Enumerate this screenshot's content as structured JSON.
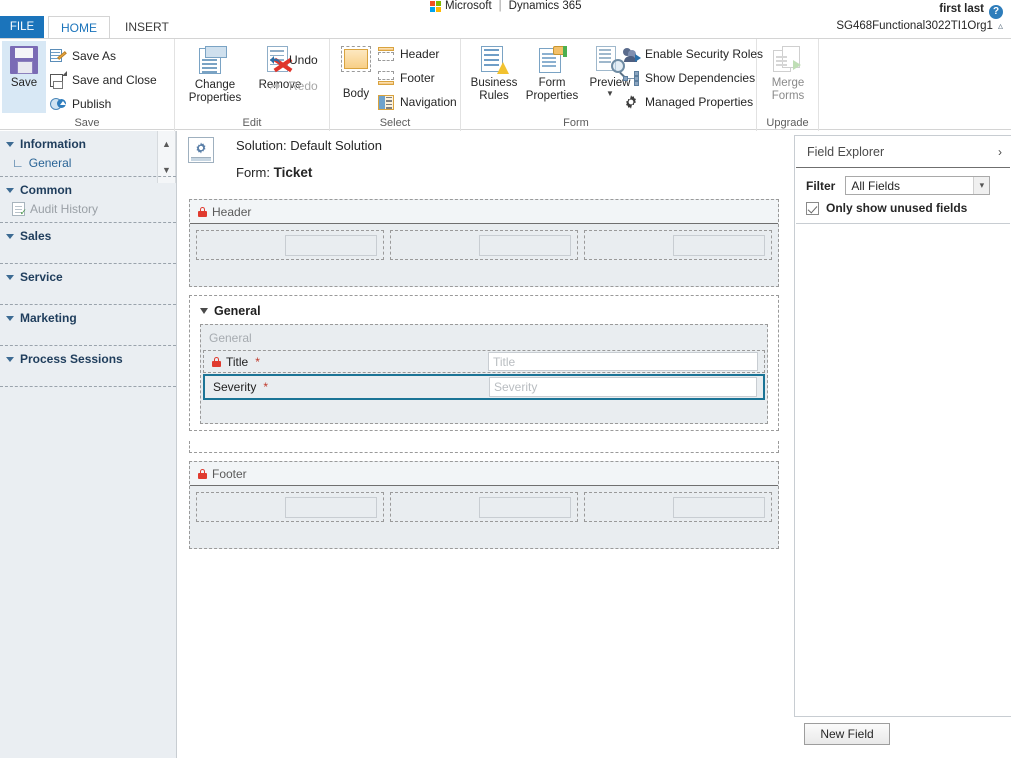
{
  "brand": {
    "company": "Microsoft",
    "separator": "|",
    "product": "Dynamics 365",
    "logo_icon": "microsoft-logo-icon",
    "colors": {
      "red": "#f25022",
      "green": "#7fba00",
      "blue": "#00a4ef",
      "yellow": "#ffb900"
    }
  },
  "user": {
    "name": "first last",
    "org": "SG468Functional3022TI1Org1",
    "help_icon": "help-question-icon",
    "help_label": "?",
    "collapse_icon": "chevron-up-icon"
  },
  "tabs": [
    {
      "label": "FILE",
      "id": "file",
      "active": false
    },
    {
      "label": "HOME",
      "id": "home",
      "active": true
    },
    {
      "label": "INSERT",
      "id": "insert",
      "active": false
    }
  ],
  "ribbon": {
    "groups": [
      {
        "name": "Save",
        "label": "Save",
        "big": {
          "label": "Save",
          "icon": "floppy-disk-icon",
          "selected": true
        },
        "items": [
          {
            "label": "Save As",
            "icon": "save-as-icon",
            "disabled": false
          },
          {
            "label": "Save and Close",
            "icon": "save-and-close-icon",
            "disabled": false
          },
          {
            "label": "Publish",
            "icon": "publish-globe-icon",
            "disabled": false
          }
        ]
      },
      {
        "name": "Edit",
        "label": "Edit",
        "buttons": [
          {
            "label": "Change Properties",
            "icon": "change-properties-icon"
          },
          {
            "label": "Remove",
            "icon": "remove-x-icon"
          }
        ],
        "items": [
          {
            "label": "Undo",
            "icon": "undo-arrow-icon",
            "disabled": false
          },
          {
            "label": "Redo",
            "icon": "redo-arrow-icon",
            "disabled": true
          }
        ]
      },
      {
        "name": "Select",
        "label": "Select",
        "big": {
          "label": "Body",
          "icon": "body-region-icon"
        },
        "items": [
          {
            "label": "Header",
            "icon": "header-region-icon"
          },
          {
            "label": "Footer",
            "icon": "footer-region-icon"
          },
          {
            "label": "Navigation",
            "icon": "navigation-region-icon"
          }
        ]
      },
      {
        "name": "Form",
        "label": "Form",
        "buttons": [
          {
            "label": "Business Rules",
            "icon": "business-rules-icon"
          },
          {
            "label": "Form Properties",
            "icon": "form-properties-icon"
          },
          {
            "label": "Preview",
            "icon": "preview-magnifier-icon",
            "has_dropdown": true
          }
        ],
        "items": [
          {
            "label": "Enable Security Roles",
            "icon": "security-roles-icon"
          },
          {
            "label": "Show Dependencies",
            "icon": "show-dependencies-icon"
          },
          {
            "label": "Managed Properties",
            "icon": "gear-icon"
          }
        ]
      },
      {
        "name": "Upgrade",
        "label": "Upgrade",
        "big": {
          "label": "Merge Forms",
          "icon": "merge-forms-icon",
          "disabled": true
        }
      }
    ]
  },
  "sidebar": {
    "scroll_up_icon": "chevron-up-icon",
    "scroll_down_icon": "chevron-down-icon",
    "sections": [
      {
        "label": "Information",
        "items": [
          {
            "label": "General",
            "icon": "tree-branch-icon",
            "active": true
          }
        ]
      },
      {
        "label": "Common",
        "items": [
          {
            "label": "Audit History",
            "icon": "audit-history-icon",
            "disabled": true
          }
        ]
      },
      {
        "label": "Sales",
        "items": []
      },
      {
        "label": "Service",
        "items": []
      },
      {
        "label": "Marketing",
        "items": []
      },
      {
        "label": "Process Sessions",
        "items": []
      }
    ]
  },
  "form": {
    "solution_icon": "solution-gear-icon",
    "solution_line": "Solution: Default Solution",
    "form_prefix": "Form:",
    "form_name": "Ticket",
    "header_section": {
      "title": "Header",
      "lock_icon": "lock-icon",
      "columns": [
        {
          "placeholder": ""
        },
        {
          "placeholder": ""
        },
        {
          "placeholder": ""
        }
      ]
    },
    "general_tab": {
      "title": "General",
      "collapse_icon": "triangle-down-icon",
      "section_label": "General",
      "fields": [
        {
          "label": "Title",
          "required_marker": "*",
          "locked": true,
          "lock_icon": "lock-icon",
          "control_placeholder": "Title",
          "selected": false
        },
        {
          "label": "Severity",
          "required_marker": "*",
          "locked": false,
          "control_placeholder": "Severity",
          "selected": true
        }
      ]
    },
    "footer_section": {
      "title": "Footer",
      "lock_icon": "lock-icon",
      "columns": [
        {
          "placeholder": ""
        },
        {
          "placeholder": ""
        },
        {
          "placeholder": ""
        }
      ]
    }
  },
  "field_explorer": {
    "title": "Field Explorer",
    "expand_icon": "chevron-right-icon",
    "expand_glyph": "›",
    "filter_label": "Filter",
    "filter_value": "All Fields",
    "filter_dropdown_icon": "chevron-down-icon",
    "filter_dropdown_glyph": "⌄",
    "checkbox_label": "Only show unused fields",
    "checkbox_checked": true,
    "new_field_button": "New Field"
  },
  "colors": {
    "accent_blue": "#1b74bb",
    "tab_text_blue": "#1b74bb",
    "selection_teal": "#1b7496",
    "required_red": "#c0392b",
    "lock_red": "#e03b2f",
    "canvas_grey": "#e9edf0",
    "nav_grey": "#eaeef2"
  }
}
